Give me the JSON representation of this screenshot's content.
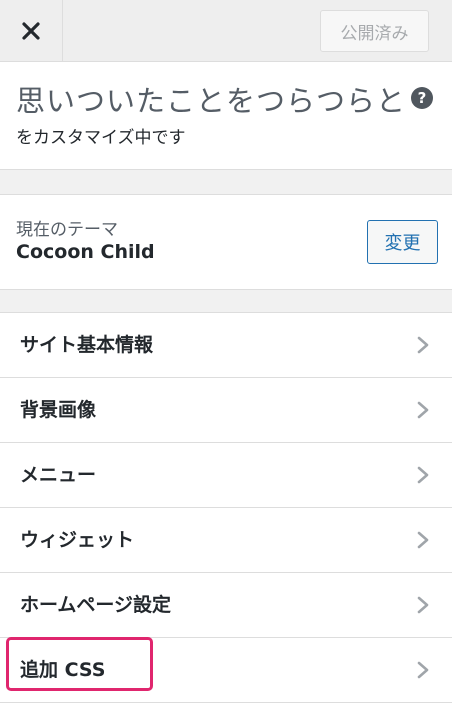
{
  "header": {
    "close_label": "✕",
    "publish_label": "公開済み"
  },
  "info": {
    "site_title": "思いついたことをつらつらと",
    "help_label": "?",
    "customizing_text": "をカスタマイズ中です"
  },
  "theme": {
    "caption": "現在のテーマ",
    "name": "Cocoon Child",
    "change_label": "変更"
  },
  "menu": {
    "items": [
      {
        "label": "サイト基本情報"
      },
      {
        "label": "背景画像"
      },
      {
        "label": "メニュー"
      },
      {
        "label": "ウィジェット"
      },
      {
        "label": "ホームページ設定"
      },
      {
        "label": "追加 CSS"
      }
    ]
  },
  "colors": {
    "accent": "#2271b1",
    "highlight": "#e0266e"
  }
}
